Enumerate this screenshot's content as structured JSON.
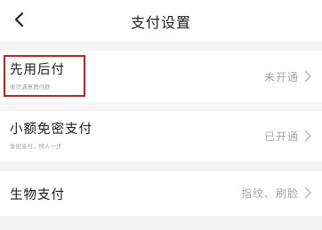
{
  "header": {
    "back_icon": "chevron-left-icon",
    "title": "支付设置"
  },
  "rows": [
    {
      "title": "先用后付",
      "subtitle": "收货满意再付款",
      "status": "未开通",
      "chevron_icon": "chevron-right-icon",
      "highlighted": true,
      "highlight_color": "#b42424"
    },
    {
      "title": "小额免密支付",
      "subtitle": "免密支付，快人一步",
      "status": "已开通",
      "chevron_icon": "chevron-right-icon"
    },
    {
      "title": "生物支付",
      "subtitle": "",
      "status": "指纹、刷脸",
      "chevron_icon": "chevron-right-icon"
    }
  ],
  "colors": {
    "background": "#f4f4f4",
    "card": "#ffffff",
    "secondary_text": "#a6a6a6"
  }
}
